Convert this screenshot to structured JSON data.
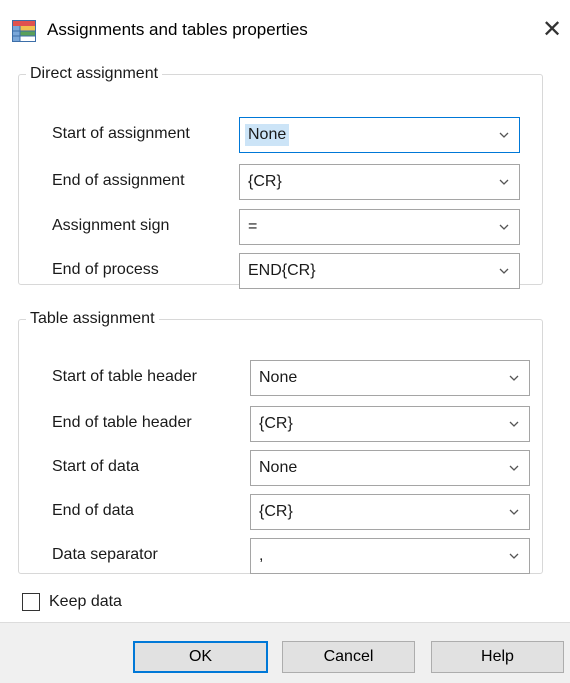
{
  "window": {
    "title": "Assignments and tables properties",
    "close_glyph": "✕"
  },
  "direct": {
    "legend": "Direct assignment",
    "rows": [
      {
        "label": "Start of assignment",
        "value": "None"
      },
      {
        "label": "End of assignment",
        "value": "{CR}"
      },
      {
        "label": "Assignment sign",
        "value": "="
      },
      {
        "label": "End of process",
        "value": "END{CR}"
      }
    ]
  },
  "table": {
    "legend": "Table assignment",
    "rows": [
      {
        "label": "Start of table header",
        "value": "None"
      },
      {
        "label": "End of table header",
        "value": "{CR}"
      },
      {
        "label": "Start of data",
        "value": "None"
      },
      {
        "label": "End of data",
        "value": "{CR}"
      },
      {
        "label": "Data separator",
        "value": ","
      }
    ]
  },
  "keep_data": {
    "label": "Keep data",
    "checked": false
  },
  "buttons": {
    "ok": "OK",
    "cancel": "Cancel",
    "help": "Help"
  },
  "icons": {
    "app": "table-properties-icon",
    "close": "close-icon",
    "dropdown": "chevron-down-icon"
  },
  "colors": {
    "focus_border": "#0078d7",
    "selection": "#cce4f7",
    "footer_bg": "#f0f0f0"
  }
}
